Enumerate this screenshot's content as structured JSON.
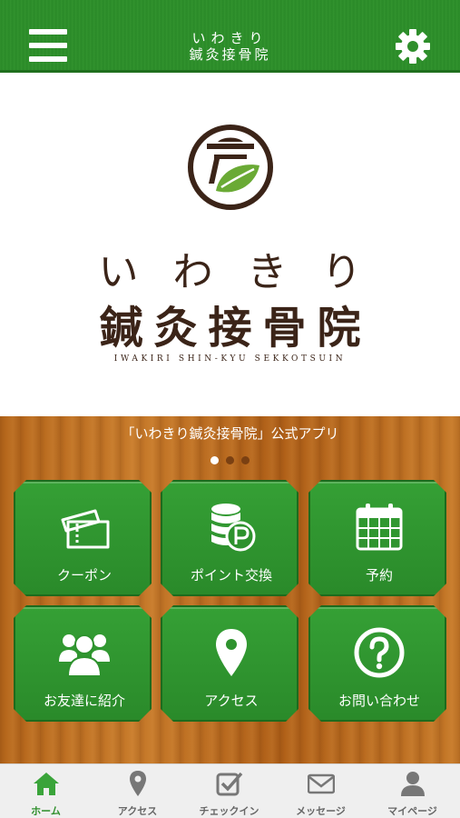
{
  "header": {
    "title_line1": "いわきり",
    "title_line2": "鍼灸接骨院",
    "background_color": "#2f8f2c",
    "menu_icon": "hamburger-menu-icon",
    "settings_icon": "gear-icon"
  },
  "brand": {
    "name_kana": "いわきり",
    "name_kanji": "鍼灸接骨院",
    "name_roman": "IWAKIRI SHIN-KYU SEKKOTSUIN",
    "text_color": "#3b2418"
  },
  "carousel": {
    "caption": "「いわきり鍼灸接骨院」公式アプリ",
    "page_count": 3,
    "active_page": 1
  },
  "tiles": [
    {
      "label": "クーポン",
      "icon": "ticket-icon"
    },
    {
      "label": "ポイント交換",
      "icon": "coins-icon"
    },
    {
      "label": "予約",
      "icon": "calendar-icon"
    },
    {
      "label": "お友達に紹介",
      "icon": "people-icon"
    },
    {
      "label": "アクセス",
      "icon": "map-pin-icon"
    },
    {
      "label": "お問い合わせ",
      "icon": "question-icon"
    }
  ],
  "tabbar": {
    "active_color": "#2f8f2c",
    "items": [
      {
        "label": "ホーム",
        "icon": "home-icon",
        "active": true
      },
      {
        "label": "アクセス",
        "icon": "map-pin-icon",
        "active": false
      },
      {
        "label": "チェックイン",
        "icon": "checkin-icon",
        "active": false
      },
      {
        "label": "メッセージ",
        "icon": "envelope-icon",
        "active": false
      },
      {
        "label": "マイページ",
        "icon": "user-icon",
        "active": false
      }
    ]
  }
}
